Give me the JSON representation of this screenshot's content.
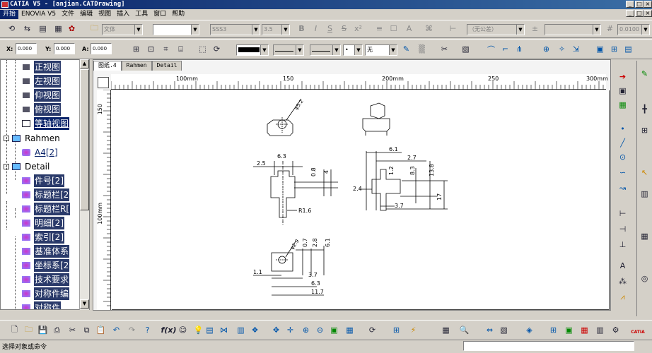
{
  "window": {
    "title": "CATIA V5 - [anjian.CATDrawing]"
  },
  "menu": [
    {
      "label": "开始",
      "active": true
    },
    {
      "label": "ENOVIA V5"
    },
    {
      "label": "文件"
    },
    {
      "label": "编辑"
    },
    {
      "label": "视图"
    },
    {
      "label": "插入"
    },
    {
      "label": "工具"
    },
    {
      "label": "窗口"
    },
    {
      "label": "帮助"
    }
  ],
  "toolbar": {
    "font_style": "文体",
    "font_name": "SSS3",
    "font_size": "3.5",
    "tolerance": "（无公差）",
    "precision": "0.0100",
    "x_label": "X:",
    "x_value": "0.000",
    "y_label": "Y:",
    "y_value": "0.000",
    "a_label": "A:",
    "a_value": "0.000",
    "fill_none": "无"
  },
  "tree": {
    "items": [
      {
        "label": "正视图"
      },
      {
        "label": "左视图"
      },
      {
        "label": "仰视图"
      },
      {
        "label": "俯视图"
      },
      {
        "label": "等轴视图"
      },
      {
        "label": "Rahmen"
      },
      {
        "label": "A4[2]"
      },
      {
        "label": "Detail"
      },
      {
        "label": "件号[2]"
      },
      {
        "label": "标题栏[2"
      },
      {
        "label": "标题栏R["
      },
      {
        "label": "明细[2]"
      },
      {
        "label": "索引[2]"
      },
      {
        "label": "基准体系"
      },
      {
        "label": "坐标系[2"
      },
      {
        "label": "技术要求"
      },
      {
        "label": "对称件编"
      },
      {
        "label": "对称件"
      }
    ]
  },
  "tabs": [
    {
      "label": "图纸.4",
      "active": true
    },
    {
      "label": "Rahmen"
    },
    {
      "label": "Detail"
    }
  ],
  "ruler": {
    "h_labels": [
      "100mm",
      "150",
      "200mm",
      "250",
      "300mm"
    ],
    "v_labels": [
      "150",
      "100mm"
    ]
  },
  "drawing": {
    "dims": [
      "φ5.2",
      "6.3",
      "2.5",
      "0.8",
      "4",
      "R1.6",
      "6.1",
      "2.7",
      "1.2",
      "8.3",
      "13.8",
      "2.4",
      "3.7",
      "17",
      "φ2.9",
      "0.7",
      "2.8",
      "6.1",
      "1.1",
      "3.7",
      "6.3",
      "11.7"
    ]
  },
  "status": {
    "text": "选择对象或命令"
  },
  "brand": {
    "logo": "CATIA"
  }
}
